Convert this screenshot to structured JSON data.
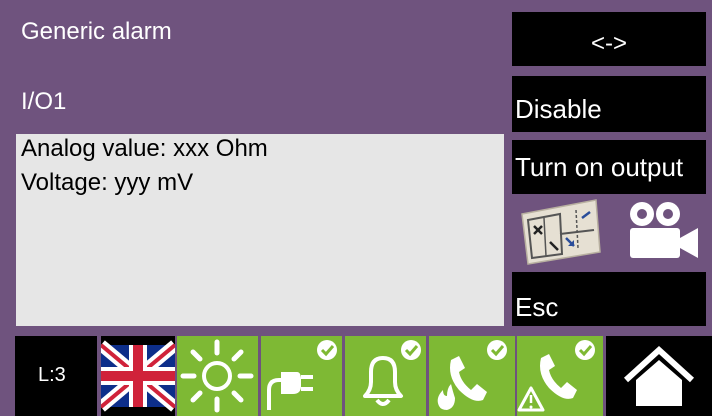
{
  "alarm": {
    "title": "Generic alarm",
    "io_label": "I/O1",
    "analog_value": "Analog value: xxx Ohm",
    "voltage": "Voltage: yyy mV"
  },
  "actions": {
    "swap_label": "<->",
    "disable_label": "Disable",
    "turn_on_output_label": "Turn on output",
    "esc_label": "Esc"
  },
  "icons": {
    "map": "floor-plan-map-icon",
    "camera": "video-camera-icon",
    "flag": "uk-flag-icon",
    "sun": "sun-icon",
    "power": "power-plug-check-icon",
    "bell": "bell-check-icon",
    "fire_call": "phone-fire-check-icon",
    "warning_call": "phone-warning-check-icon",
    "home": "home-icon"
  },
  "status_bar": {
    "level": "L:3"
  },
  "colors": {
    "background": "#6f537e",
    "panel": "#e6e6e6",
    "button": "#000000",
    "status_green": "#7eb934",
    "flag_blue": "#0d2e8a",
    "flag_red": "#d0223a"
  }
}
